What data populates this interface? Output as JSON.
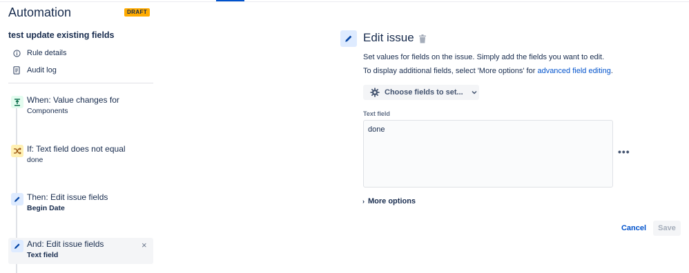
{
  "app": {
    "title": "Automation",
    "status_badge": "DRAFT",
    "rule_name": "test update existing fields"
  },
  "nav": [
    {
      "label": "Rule details",
      "icon": "info-icon"
    },
    {
      "label": "Audit log",
      "icon": "document-icon"
    }
  ],
  "steps": [
    {
      "title": "When: Value changes for",
      "subtitle": "Components",
      "kind": "trigger",
      "icon": "trigger-icon"
    },
    {
      "title": "If: Text field does not equal",
      "subtitle": "done",
      "kind": "condition",
      "icon": "shuffle-icon"
    },
    {
      "title": "Then: Edit issue fields",
      "subtitle": "Begin Date",
      "kind": "action",
      "icon": "pencil-icon"
    },
    {
      "title": "And: Edit issue fields",
      "subtitle": "Text field",
      "kind": "action",
      "icon": "pencil-icon",
      "selected": true
    }
  ],
  "editor": {
    "title": "Edit issue",
    "description": "Set values for fields on the issue. Simply add the fields you want to edit.",
    "description2_prefix": "To display additional fields, select 'More options' for ",
    "description2_link": "advanced field editing",
    "description2_suffix": ".",
    "choose_fields_label": "Choose fields to set...",
    "field_label": "Text field",
    "field_value": "done",
    "more_options_label": "More options",
    "cancel_label": "Cancel",
    "save_label": "Save"
  },
  "colors": {
    "accent": "#0052cc",
    "draft": "#ffab00",
    "trigger": "#e3fcef",
    "condition": "#fff0b3",
    "action": "#deebff"
  }
}
